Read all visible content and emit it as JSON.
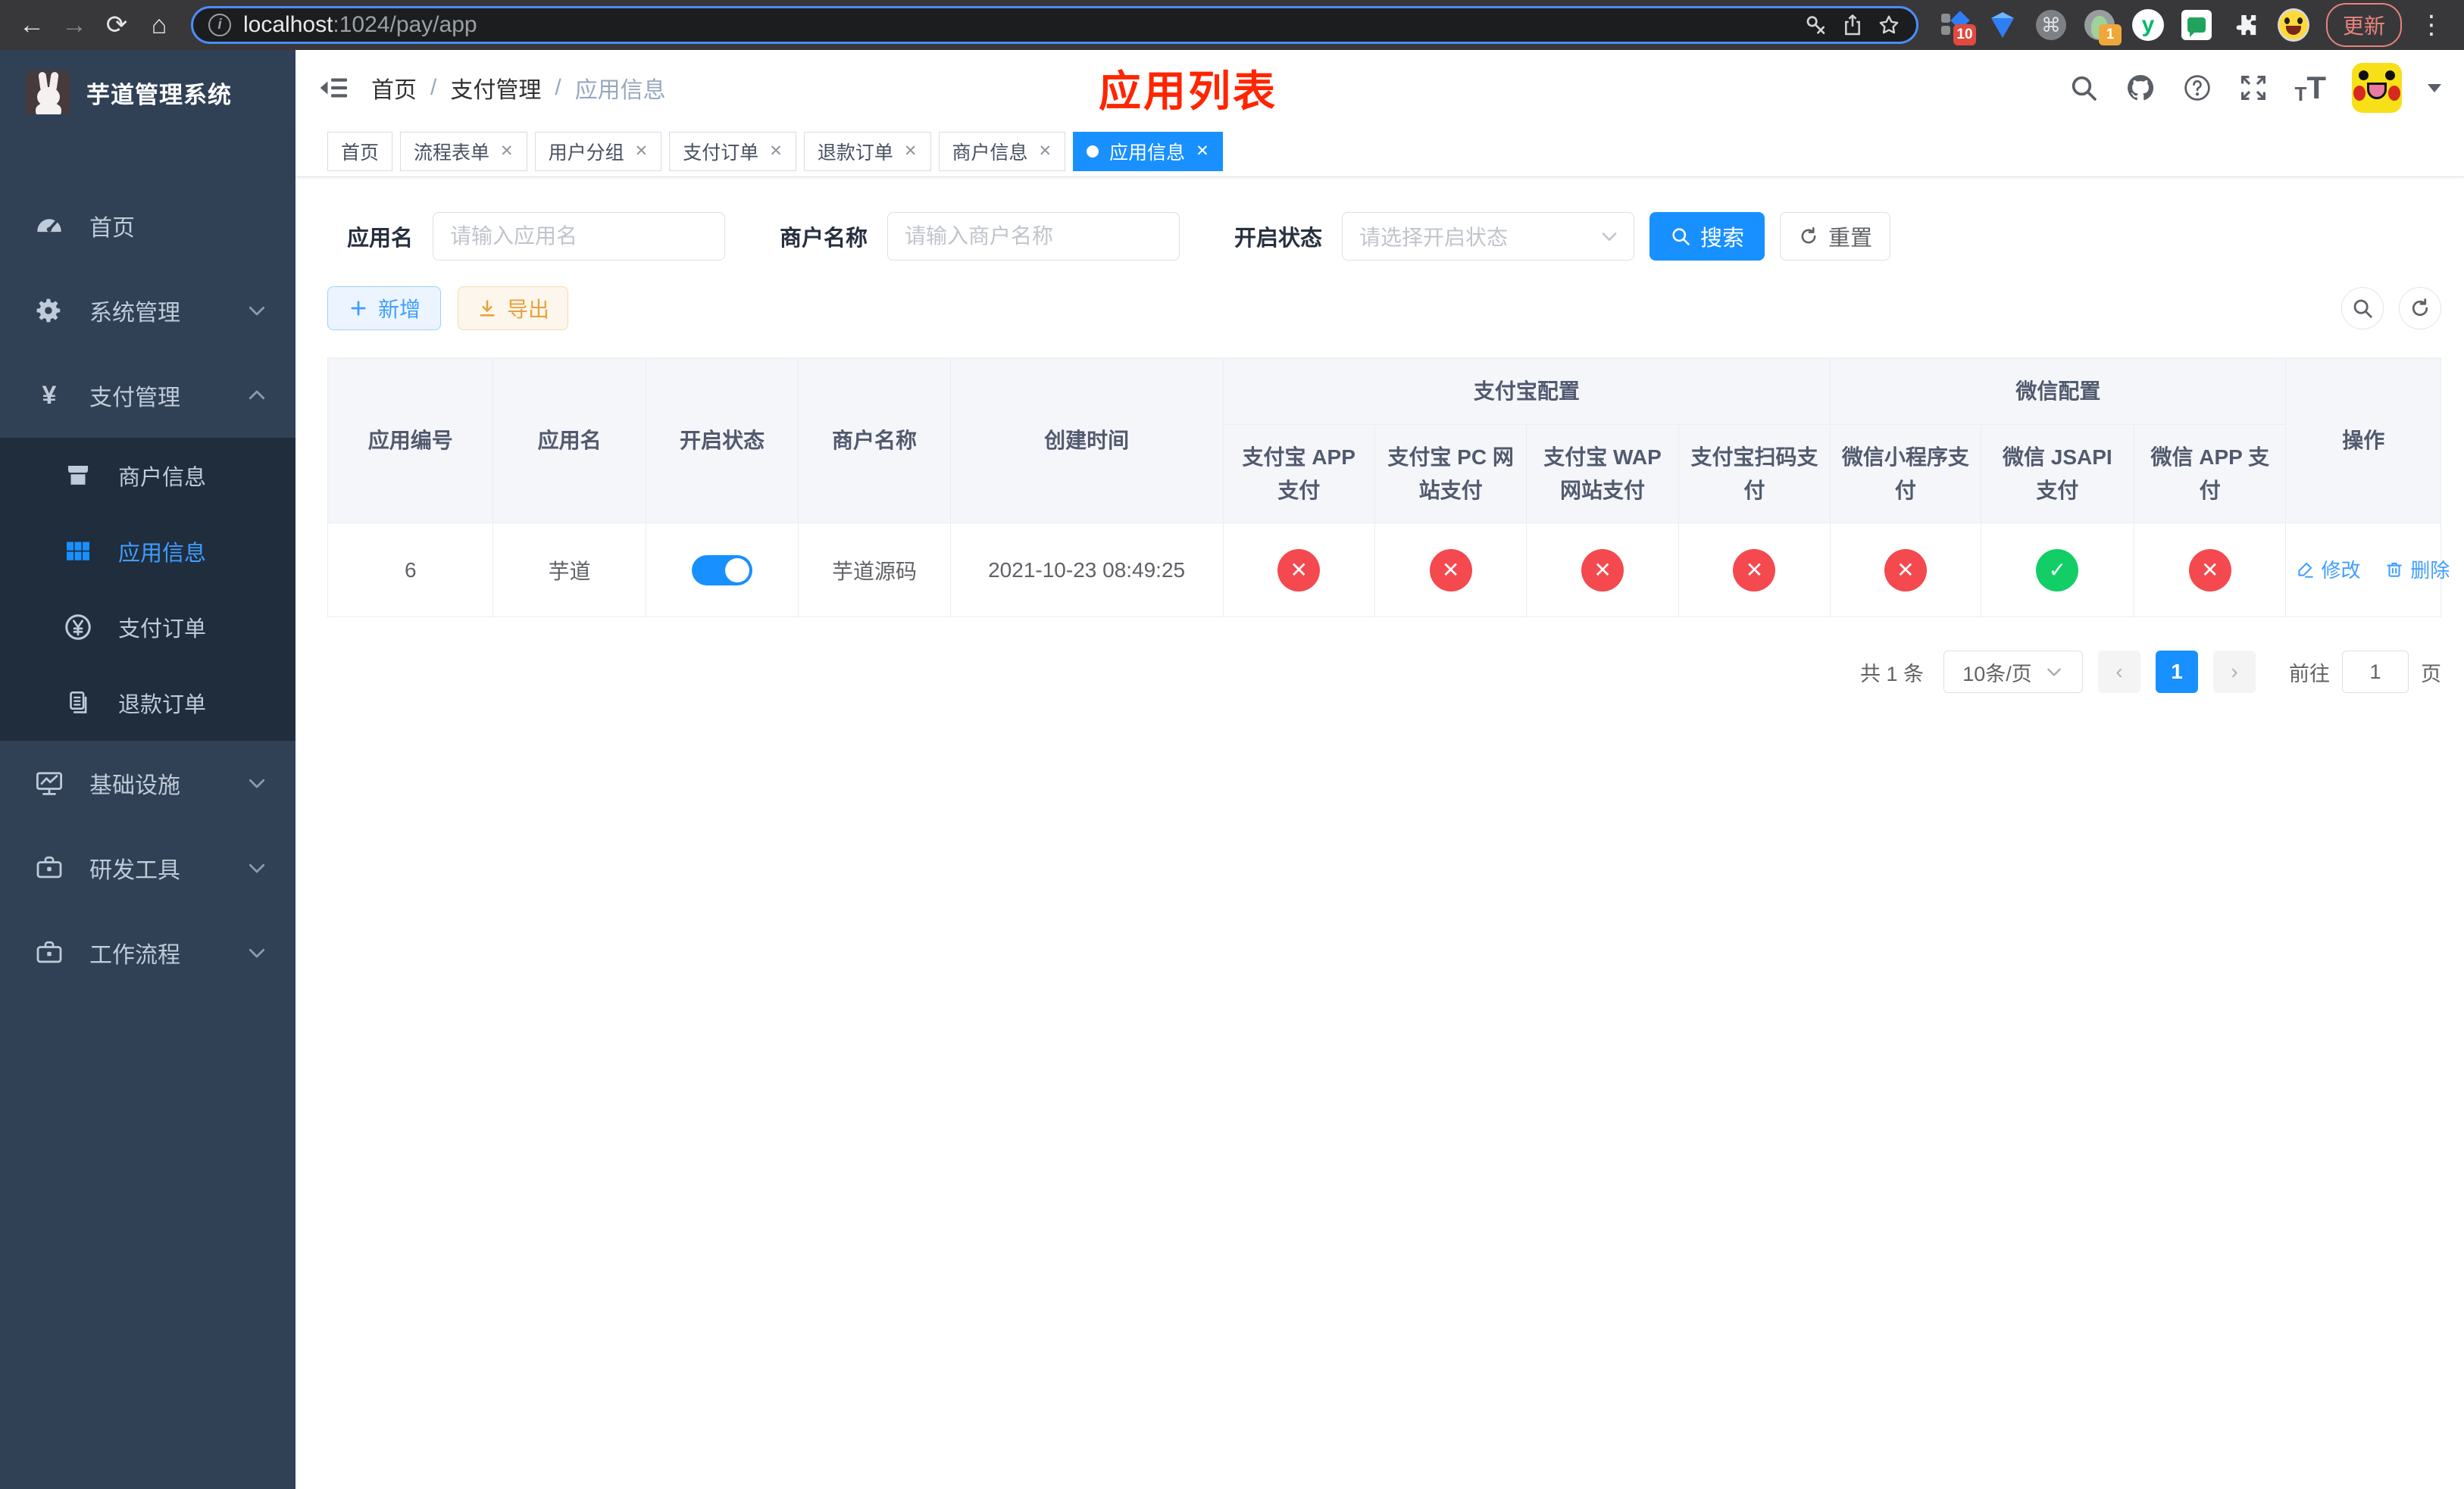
{
  "browser": {
    "url_host": "localhost",
    "url_path": ":1024/pay/app",
    "ext_badge": "10",
    "avatar_badge": "1",
    "update_label": "更新"
  },
  "sidebar": {
    "title": "芋道管理系统",
    "items": [
      {
        "label": "首页"
      },
      {
        "label": "系统管理"
      },
      {
        "label": "支付管理"
      },
      {
        "label": "基础设施"
      },
      {
        "label": "研发工具"
      },
      {
        "label": "工作流程"
      }
    ],
    "submenu": [
      {
        "label": "商户信息"
      },
      {
        "label": "应用信息"
      },
      {
        "label": "支付订单"
      },
      {
        "label": "退款订单"
      }
    ]
  },
  "header": {
    "breadcrumb": {
      "home": "首页",
      "section": "支付管理",
      "current": "应用信息"
    },
    "annotation": "应用列表"
  },
  "tabs": [
    {
      "label": "首页",
      "closable": false,
      "active": false
    },
    {
      "label": "流程表单",
      "closable": true,
      "active": false
    },
    {
      "label": "用户分组",
      "closable": true,
      "active": false
    },
    {
      "label": "支付订单",
      "closable": true,
      "active": false
    },
    {
      "label": "退款订单",
      "closable": true,
      "active": false
    },
    {
      "label": "商户信息",
      "closable": true,
      "active": false
    },
    {
      "label": "应用信息",
      "closable": true,
      "active": true
    }
  ],
  "filters": {
    "app_name_label": "应用名",
    "app_name_placeholder": "请输入应用名",
    "merchant_label": "商户名称",
    "merchant_placeholder": "请输入商户名称",
    "status_label": "开启状态",
    "status_placeholder": "请选择开启状态",
    "search_label": "搜索",
    "reset_label": "重置"
  },
  "toolbar": {
    "add_label": "新增",
    "export_label": "导出"
  },
  "table": {
    "headers": {
      "app_id": "应用编号",
      "app_name": "应用名",
      "status": "开启状态",
      "merchant": "商户名称",
      "created": "创建时间",
      "alipay_group": "支付宝配置",
      "wechat_group": "微信配置",
      "alipay_app": "支付宝 APP 支付",
      "alipay_pc": "支付宝 PC 网站支付",
      "alipay_wap": "支付宝 WAP 网站支付",
      "alipay_scan": "支付宝扫码支付",
      "wechat_lite": "微信小程序支付",
      "wechat_jsapi": "微信 JSAPI 支付",
      "wechat_app": "微信 APP 支付",
      "ops": "操作"
    },
    "row": {
      "app_id": "6",
      "app_name": "芋道",
      "enabled": true,
      "merchant": "芋道源码",
      "created": "2021-10-23 08:49:25",
      "channels": {
        "alipay_app": false,
        "alipay_pc": false,
        "alipay_wap": false,
        "alipay_scan": false,
        "wechat_lite": false,
        "wechat_jsapi": true,
        "wechat_app": false
      },
      "edit_label": "修改",
      "delete_label": "删除"
    }
  },
  "pagination": {
    "total": "共 1 条",
    "page_size": "10条/页",
    "page": "1",
    "goto_label": "前往",
    "goto_value": "1",
    "unit_label": "页"
  },
  "icons": {
    "cross": "✕",
    "check": "✓",
    "info": "i",
    "command": "⌘",
    "yuque": "y"
  },
  "colors": {
    "accent": "#1890ff",
    "link": "#409eff",
    "danger": "#f4494f",
    "success": "#13ce66",
    "warning": "#e6a23c",
    "sidebar_bg": "#304156",
    "submenu_bg": "#1f2d3d"
  }
}
